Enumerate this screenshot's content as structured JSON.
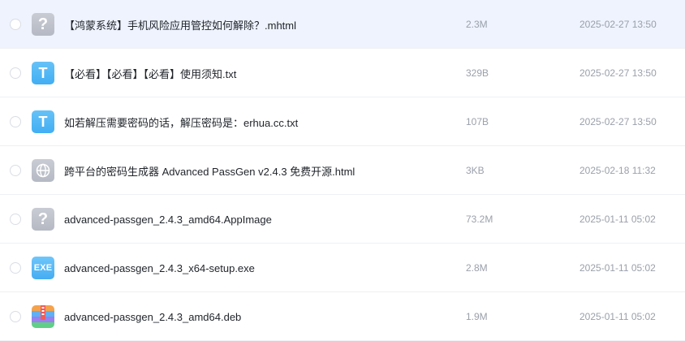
{
  "files": [
    {
      "icon": "unknown-file-icon",
      "icon_char": "?",
      "name": "【鸿蒙系统】手机风险应用管控如何解除？.mhtml",
      "size": "2.3M",
      "time": "2025-02-27 13:50",
      "selected": true
    },
    {
      "icon": "txt-file-icon",
      "icon_char": "T",
      "name": "【必看】【必看】【必看】使用须知.txt",
      "size": "329B",
      "time": "2025-02-27 13:50"
    },
    {
      "icon": "txt-file-icon",
      "icon_char": "T",
      "name": "如若解压需要密码的话，解压密码是：erhua.cc.txt",
      "size": "107B",
      "time": "2025-02-27 13:50"
    },
    {
      "icon": "html-file-icon",
      "icon_char": "",
      "name": "跨平台的密码生成器 Advanced PassGen v2.4.3 免费开源.html",
      "size": "3KB",
      "time": "2025-02-18 11:32"
    },
    {
      "icon": "unknown-file-icon",
      "icon_char": "?",
      "name": "advanced-passgen_2.4.3_amd64.AppImage",
      "size": "73.2M",
      "time": "2025-01-11 05:02"
    },
    {
      "icon": "exe-file-icon",
      "icon_char": "EXE",
      "name": "advanced-passgen_2.4.3_x64-setup.exe",
      "size": "2.8M",
      "time": "2025-01-11 05:02"
    },
    {
      "icon": "archive-file-icon",
      "icon_char": "",
      "name": "advanced-passgen_2.4.3_amd64.deb",
      "size": "1.9M",
      "time": "2025-01-11 05:02"
    }
  ]
}
